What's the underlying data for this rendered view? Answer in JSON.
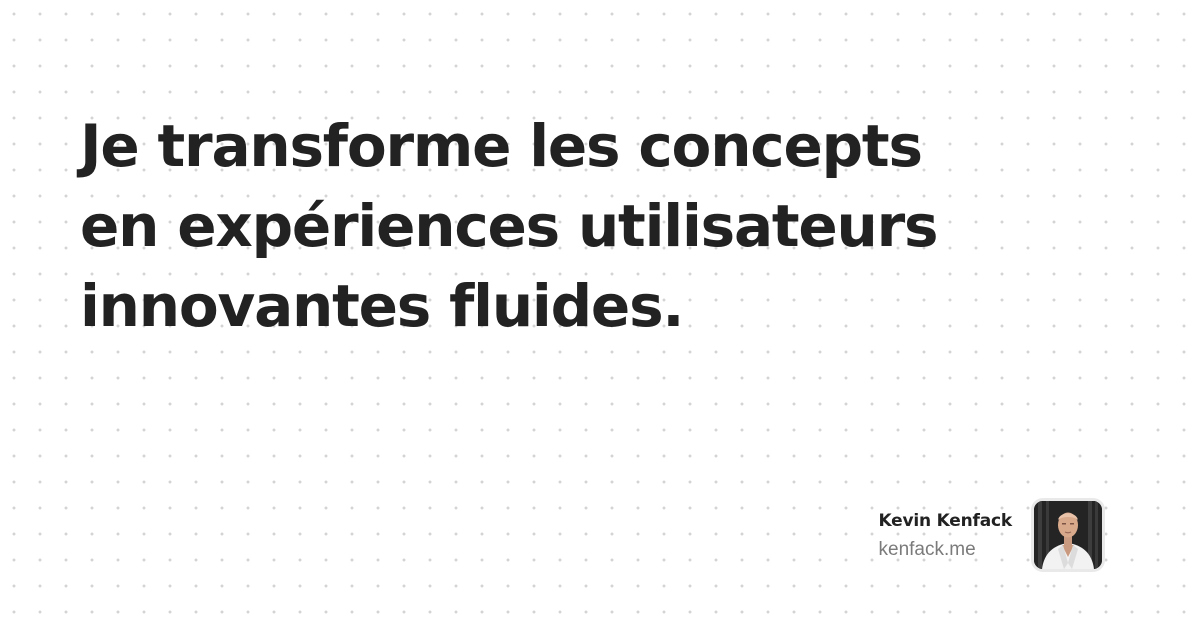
{
  "headline": {
    "lines": [
      "Je transforme les concepts",
      "en expériences utilisateurs",
      "innovantes fluides."
    ]
  },
  "author": {
    "name": "Kevin Kenfack",
    "site": "kenfack.me",
    "avatar_icon": "person-photo-icon"
  },
  "colors": {
    "background": "#ffffff",
    "dots": "#d4d4d4",
    "text": "#222222",
    "muted": "#7b7b7b"
  }
}
